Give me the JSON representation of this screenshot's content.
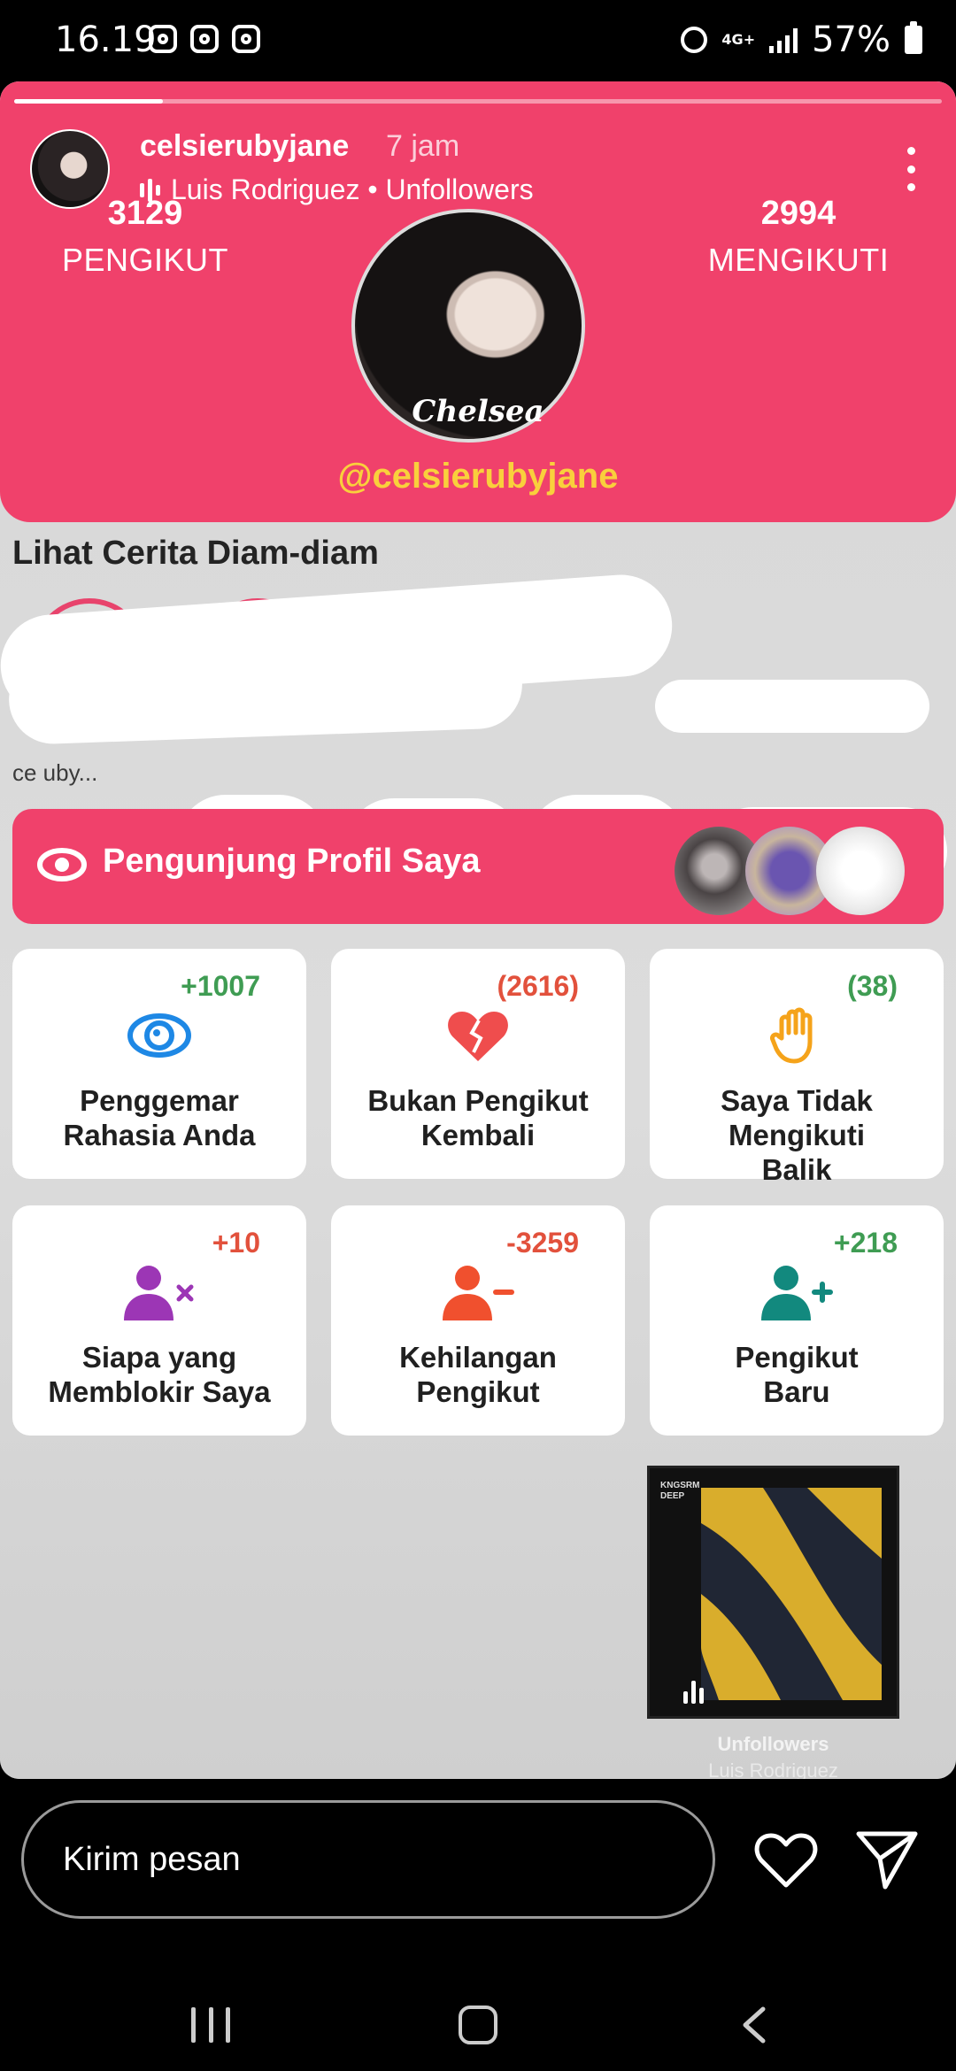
{
  "status_bar": {
    "time": "16.19",
    "network": "4G+",
    "battery": "57%"
  },
  "story": {
    "progress": 0.16,
    "username": "celsierubyjane",
    "time_ago": "7 jam",
    "music": "Luis Rodriguez • Unfollowers"
  },
  "profile": {
    "followers_count": "3129",
    "followers_label": "PENGIKUT",
    "following_count": "2994",
    "following_label": "MENGIKUTI",
    "display_name": "Chelsea",
    "handle": "@celsierubyjane"
  },
  "stories_section": {
    "title": "Lihat Cerita Diam-diam",
    "first_label": "ce      uby..."
  },
  "visitors": {
    "label": "Pengunjung Profil Saya"
  },
  "cards": [
    {
      "count": "+1007",
      "label_1": "Penggemar",
      "label_2": "Rahasia Anda",
      "icon": "eye-icon",
      "color": "#1e88e5"
    },
    {
      "count": "(2616)",
      "label_1": "Bukan Pengikut",
      "label_2": "Kembali",
      "icon": "broken-heart-icon",
      "color": "#ef4d4d"
    },
    {
      "count": "(38)",
      "label_1": "Saya Tidak",
      "label_2": "Mengikuti",
      "label_3": "Balik",
      "icon": "hand-icon",
      "color": "#f5a31a"
    },
    {
      "count": "+10",
      "label_1": "Siapa yang",
      "label_2": "Memblokir Saya",
      "icon": "user-block-icon",
      "color": "#9c36b5"
    },
    {
      "count": "-3259",
      "label_1": "Kehilangan",
      "label_2": "Pengikut",
      "icon": "user-minus-icon",
      "color": "#f0502e"
    },
    {
      "count": "+218",
      "label_1": "Pengikut",
      "label_2": "Baru",
      "icon": "user-plus-icon",
      "color": "#12897e"
    }
  ],
  "music_sticker": {
    "album_tag_1": "KNGSRM",
    "album_tag_2": "DEEP",
    "title": "Unfollowers",
    "artist": "Luis Rodriguez"
  },
  "reply": {
    "placeholder": "Kirim pesan"
  }
}
